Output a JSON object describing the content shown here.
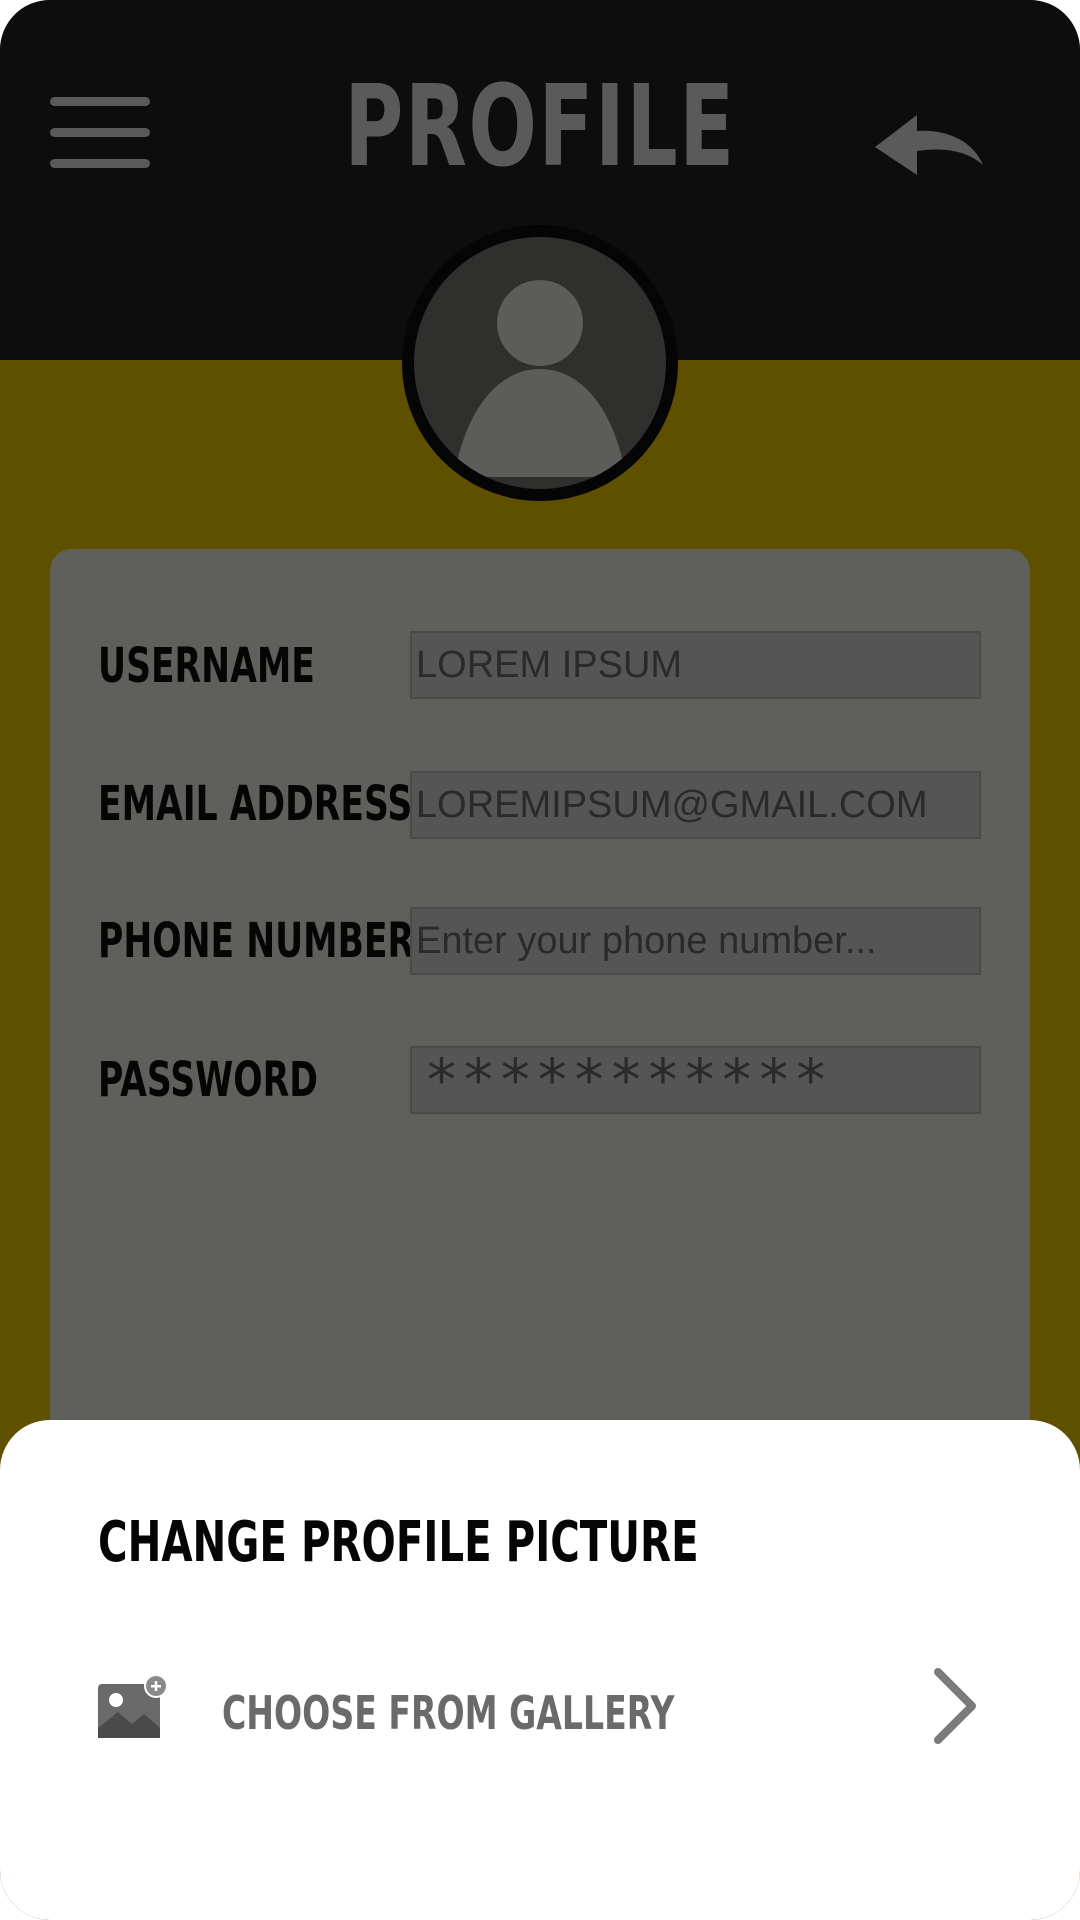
{
  "header": {
    "title": "PROFILE",
    "menu_icon": "hamburger-menu-icon",
    "back_icon": "reply-back-arrow-icon"
  },
  "avatar": {
    "icon": "user-silhouette-icon"
  },
  "form": {
    "fields": [
      {
        "label": "USERNAME",
        "value": "LOREM IPSUM",
        "placeholder": ""
      },
      {
        "label": "EMAIL ADDRESS",
        "value": "LOREMIPSUM@GMAIL.COM",
        "placeholder": ""
      },
      {
        "label": "PHONE NUMBER",
        "value": "",
        "placeholder": "Enter your phone number..."
      },
      {
        "label": "PASSWORD",
        "value": "***********",
        "placeholder": ""
      }
    ]
  },
  "bottom_sheet": {
    "title": "CHANGE PROFILE PICTURE",
    "options": [
      {
        "label": "CHOOSE FROM GALLERY",
        "icon": "gallery-add-icon",
        "trailing_icon": "chevron-right-icon"
      }
    ]
  },
  "colors": {
    "header_bg": "#0d0d0d",
    "accent_bg": "#5f5000",
    "card_bg": "#5f5f5b",
    "sheet_bg": "#ffffff"
  }
}
